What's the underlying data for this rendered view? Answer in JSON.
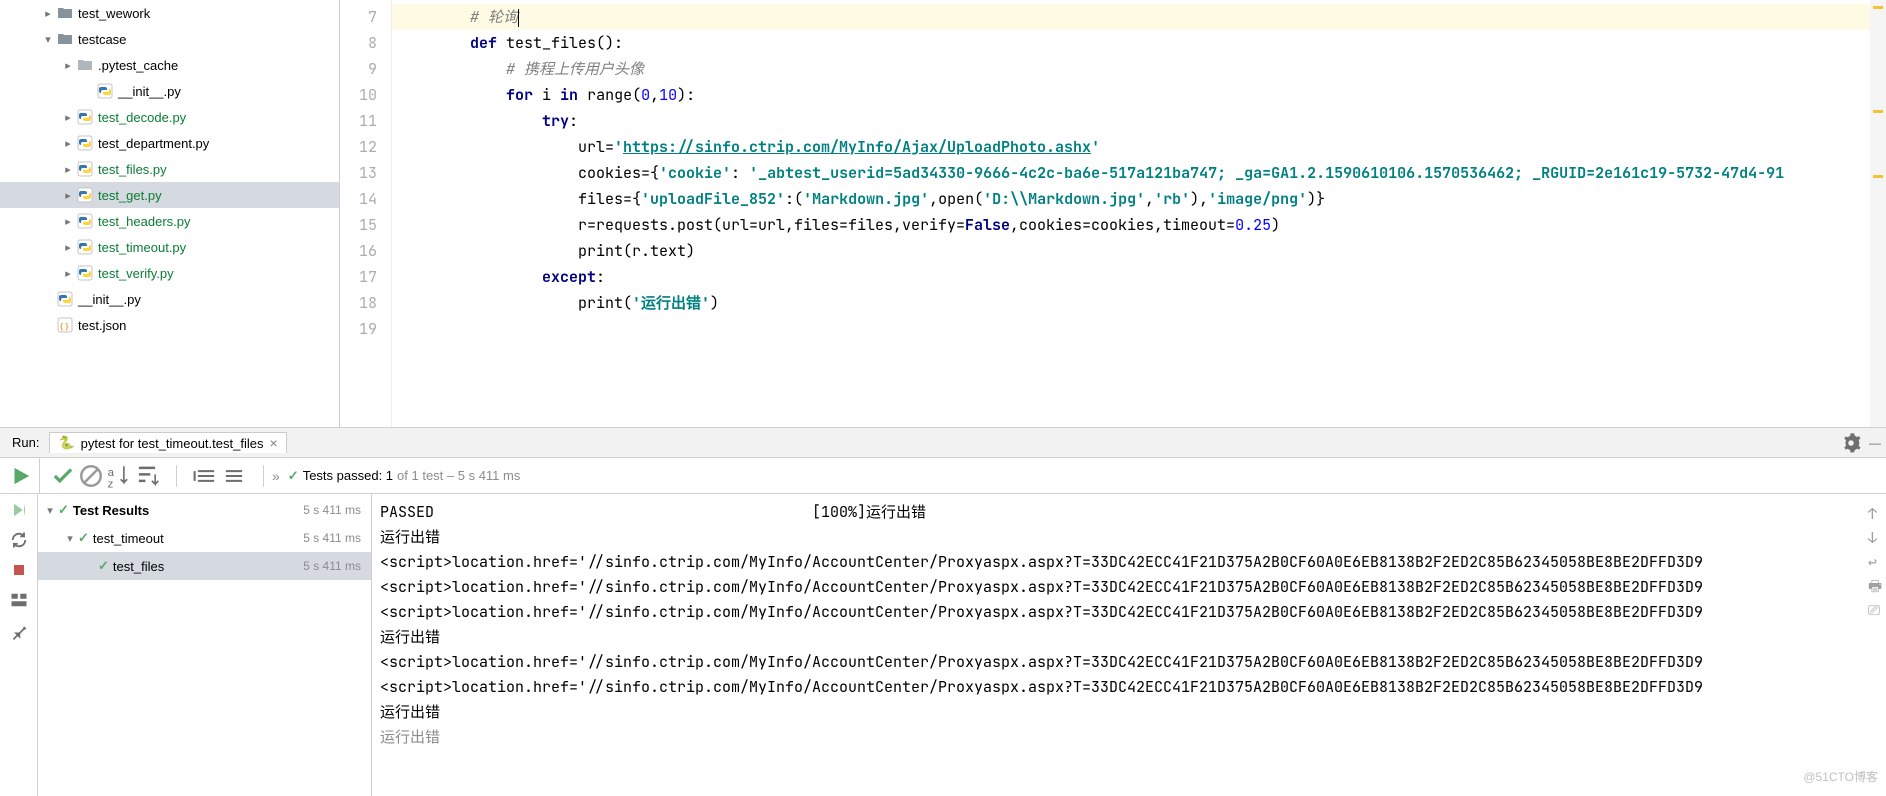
{
  "tree": {
    "items": [
      {
        "indent": 2,
        "chevron": "right",
        "icon": "folder",
        "name": "test_wework",
        "cls": ""
      },
      {
        "indent": 2,
        "chevron": "down",
        "icon": "folder",
        "name": "testcase",
        "cls": "",
        "selected": false
      },
      {
        "indent": 3,
        "chevron": "right",
        "icon": "folder-grey",
        "name": ".pytest_cache",
        "cls": ""
      },
      {
        "indent": 4,
        "chevron": "",
        "icon": "py",
        "name": "__init__.py",
        "cls": ""
      },
      {
        "indent": 3,
        "chevron": "right",
        "icon": "py",
        "name": "test_decode.py",
        "cls": "green"
      },
      {
        "indent": 3,
        "chevron": "right",
        "icon": "py",
        "name": "test_department.py",
        "cls": ""
      },
      {
        "indent": 3,
        "chevron": "right",
        "icon": "py",
        "name": "test_files.py",
        "cls": "green"
      },
      {
        "indent": 3,
        "chevron": "right",
        "icon": "py",
        "name": "test_get.py",
        "cls": "green",
        "selected": true
      },
      {
        "indent": 3,
        "chevron": "right",
        "icon": "py",
        "name": "test_headers.py",
        "cls": "green"
      },
      {
        "indent": 3,
        "chevron": "right",
        "icon": "py",
        "name": "test_timeout.py",
        "cls": "green"
      },
      {
        "indent": 3,
        "chevron": "right",
        "icon": "py",
        "name": "test_verify.py",
        "cls": "green"
      },
      {
        "indent": 2,
        "chevron": "",
        "icon": "py",
        "name": "__init__.py",
        "cls": ""
      },
      {
        "indent": 2,
        "chevron": "",
        "icon": "json",
        "name": "test.json",
        "cls": ""
      }
    ]
  },
  "editor": {
    "gutter_start": 7,
    "gutter_end": 19,
    "line7_comment": "# 轮询",
    "line8": {
      "def": "def",
      "name": " test_files",
      "paren": "():"
    },
    "line9_comment": "# 携程上传用户头像",
    "line10": {
      "for": "for",
      "i": " i ",
      "in": "in",
      "range": " range(",
      "a": "0",
      "c1": ",",
      "b": "10",
      "end": "):"
    },
    "line11": {
      "try": "try",
      "colon": ":"
    },
    "line12": {
      "pre": "url=",
      "q1": "'",
      "url": "https://sinfo.ctrip.com/MyInfo/Ajax/UploadPhoto.ashx",
      "q2": "'"
    },
    "line13": {
      "pre": "cookies={",
      "k1": "'cookie'",
      "colon": ": ",
      "v1": "'_abtest_userid=5ad34330-9666-4c2c-ba6e-517a121ba747; _ga=GA1.2.1590610106.1570536462; _RGUID=2e161c19-5732-47d4-91"
    },
    "line14": {
      "pre": "files={",
      "k1": "'uploadFile_852'",
      "c": ":(",
      "v1": "'Markdown.jpg'",
      "c2": ",open(",
      "v2": "'D:\\\\Markdown.jpg'",
      "c3": ",",
      "v3": "'rb'",
      "c4": "),",
      "v4": "'image/png'",
      "end": ")}"
    },
    "line15": {
      "pre": "r=requests.post(url=url,files=files,verify=",
      "false": "False",
      "mid": ",cookies=cookies,timeout=",
      "num": "0.25",
      "end": ")"
    },
    "line16": {
      "pre": "print(r.text)"
    },
    "line17": {
      "except": "except",
      "colon": ":"
    },
    "line18": {
      "pre": "print(",
      "str": "'运行出错'",
      "end": ")"
    }
  },
  "run": {
    "label": "Run:",
    "tab_title": "pytest for test_timeout.test_files",
    "summary_lead": "✓ ",
    "summary_text": "Tests passed: 1",
    "summary_grey": " of 1 test – 5 s 411 ms"
  },
  "results": {
    "root": {
      "name": "Test Results",
      "time": "5 s 411 ms"
    },
    "suite": {
      "name": "test_timeout",
      "time": "5 s 411 ms"
    },
    "test": {
      "name": "test_files",
      "time": "5 s 411 ms"
    }
  },
  "console": {
    "l1a": "PASSED",
    "l1b": "[100%]运行出错",
    "l2": "运行出错",
    "l3": "<script>location.href='//sinfo.ctrip.com/MyInfo/AccountCenter/Proxyaspx.aspx?T=33DC42ECC41F21D375A2B0CF60A0E6EB8138B2F2ED2C85B62345058BE8BE2DFFD3D9",
    "l4": "<script>location.href='//sinfo.ctrip.com/MyInfo/AccountCenter/Proxyaspx.aspx?T=33DC42ECC41F21D375A2B0CF60A0E6EB8138B2F2ED2C85B62345058BE8BE2DFFD3D9",
    "l5": "<script>location.href='//sinfo.ctrip.com/MyInfo/AccountCenter/Proxyaspx.aspx?T=33DC42ECC41F21D375A2B0CF60A0E6EB8138B2F2ED2C85B62345058BE8BE2DFFD3D9",
    "l6": "运行出错",
    "l7": "<script>location.href='//sinfo.ctrip.com/MyInfo/AccountCenter/Proxyaspx.aspx?T=33DC42ECC41F21D375A2B0CF60A0E6EB8138B2F2ED2C85B62345058BE8BE2DFFD3D9",
    "l8": "<script>location.href='//sinfo.ctrip.com/MyInfo/AccountCenter/Proxyaspx.aspx?T=33DC42ECC41F21D375A2B0CF60A0E6EB8138B2F2ED2C85B62345058BE8BE2DFFD3D9",
    "l9": "运行出错",
    "l10": "运行出错"
  },
  "watermark": "@51CTO博客"
}
